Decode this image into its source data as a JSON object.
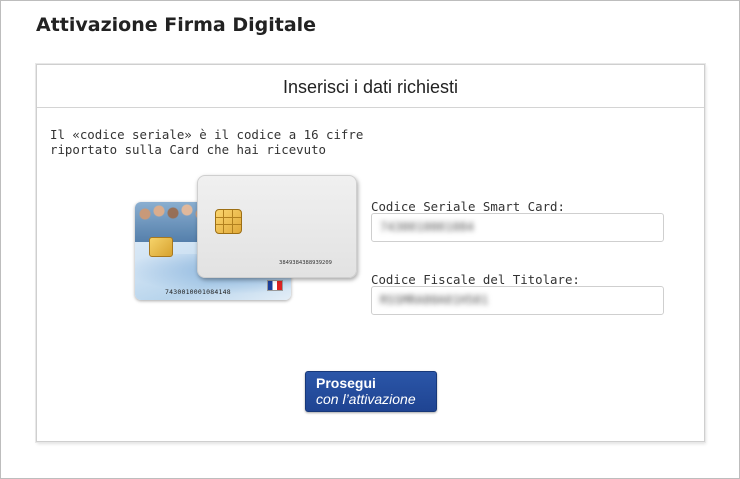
{
  "page": {
    "title": "Attivazione Firma Digitale"
  },
  "panel": {
    "title": "Inserisci i dati richiesti",
    "help_line1": "Il «codice seriale» è il codice a 16 cifre",
    "help_line2": "riportato sulla Card che hai ricevuto"
  },
  "card_illustration": {
    "back_card_number": "7430010001084148",
    "front_card_number": "3849384388939209"
  },
  "form": {
    "serial": {
      "label": "Codice Seriale Smart Card:",
      "value": "7430010001084"
    },
    "fiscal": {
      "label": "Codice Fiscale del Titolare:",
      "value": "RSSMRA80A01H501"
    }
  },
  "buttons": {
    "continue_line1": "Prosegui",
    "continue_line2": "con l’attivazione"
  },
  "colors": {
    "button_primary": "#2b56a8",
    "chip_gold": "#e0a838"
  }
}
